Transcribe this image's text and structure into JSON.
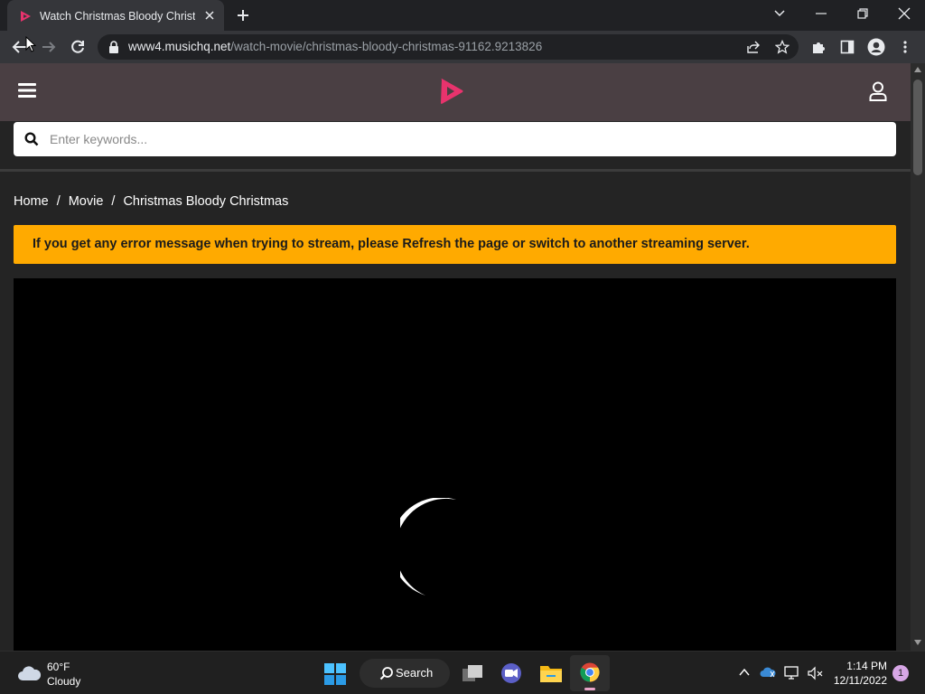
{
  "browser": {
    "tab_title": "Watch Christmas Bloody Christmas",
    "url_host": "www4.musichq.net",
    "url_path": "/watch-movie/christmas-bloody-christmas-91162.9213826"
  },
  "site": {
    "search_placeholder": "Enter keywords...",
    "breadcrumb": {
      "home": "Home",
      "movie": "Movie",
      "current": "Christmas Bloody Christmas",
      "separator": "/"
    },
    "alert_text": "If you get any error message when trying to stream, please Refresh the page or switch to another streaming server.",
    "logo_color": "#e8336d",
    "alert_color": "#ffaa00"
  },
  "taskbar": {
    "weather_temp": "60°F",
    "weather_condition": "Cloudy",
    "search_label": "Search",
    "time": "1:14 PM",
    "date": "12/11/2022",
    "notification_count": "1"
  },
  "icons": [
    "hamburger-icon",
    "site-logo",
    "user-icon",
    "search-icon",
    "spinner-icon"
  ]
}
